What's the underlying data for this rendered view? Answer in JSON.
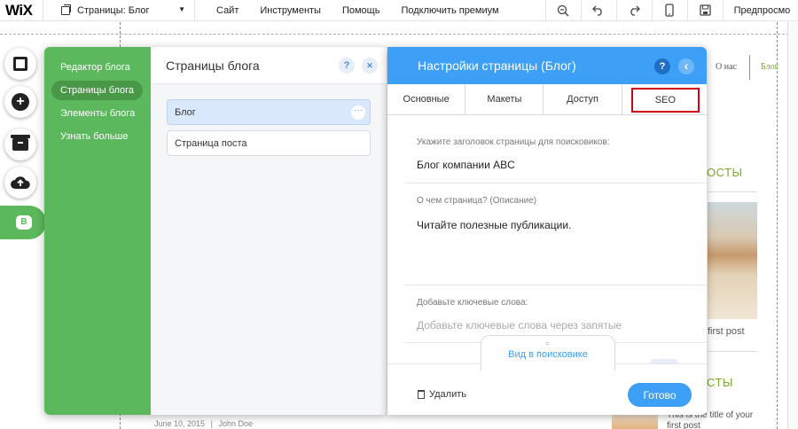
{
  "topbar": {
    "logo": "WiX",
    "pages_dropdown": "Страницы: Блог",
    "menu": [
      "Сайт",
      "Инструменты",
      "Помощь",
      "Подключить премиум"
    ],
    "preview": "Предпросмо"
  },
  "site": {
    "nav_about": "О нас",
    "nav_blog": "Блог",
    "heading1": "ОСТЫ",
    "heading2": "СТЫ",
    "post_text1": "first post",
    "post_text2": "This is the title of your",
    "post_text3": "first post",
    "meta_date": "June 10, 2015",
    "meta_author": "John Doe",
    "accent": "#7aa82e"
  },
  "blog_panel": {
    "nav": [
      "Редактор блога",
      "Страницы блога",
      "Элементы блога",
      "Узнать больше"
    ],
    "active_nav": 1,
    "pages_title": "Страницы блога",
    "help_icon": "?",
    "close_icon": "✕",
    "pages": [
      "Блог",
      "Страница поста"
    ],
    "selected_page": 0,
    "more_icon": "···",
    "accent": "#5cb85c"
  },
  "settings": {
    "title": "Настройки страницы (Блог)",
    "help_icon": "?",
    "back_icon": "‹",
    "tabs": [
      "Основные",
      "Макеты",
      "Доступ",
      "SEO"
    ],
    "active_tab": 3,
    "seo_title_label": "Укажите заголовок страницы для поисковиков:",
    "seo_title_value": "Блог компании ABC",
    "description_label": "О чем страница? (Описание)",
    "description_value": "Читайте полезные публикации.",
    "keywords_label": "Добавьте ключевые слова:",
    "keywords_placeholder": "Добавьте ключевые слова через запятые",
    "search_view_tab": "Вид в поисковике",
    "delete_label": "Удалить",
    "done_label": "Готово",
    "accent": "#3d9ff5",
    "highlight": "#d0021b"
  },
  "rail": {
    "blog_badge": "B"
  }
}
